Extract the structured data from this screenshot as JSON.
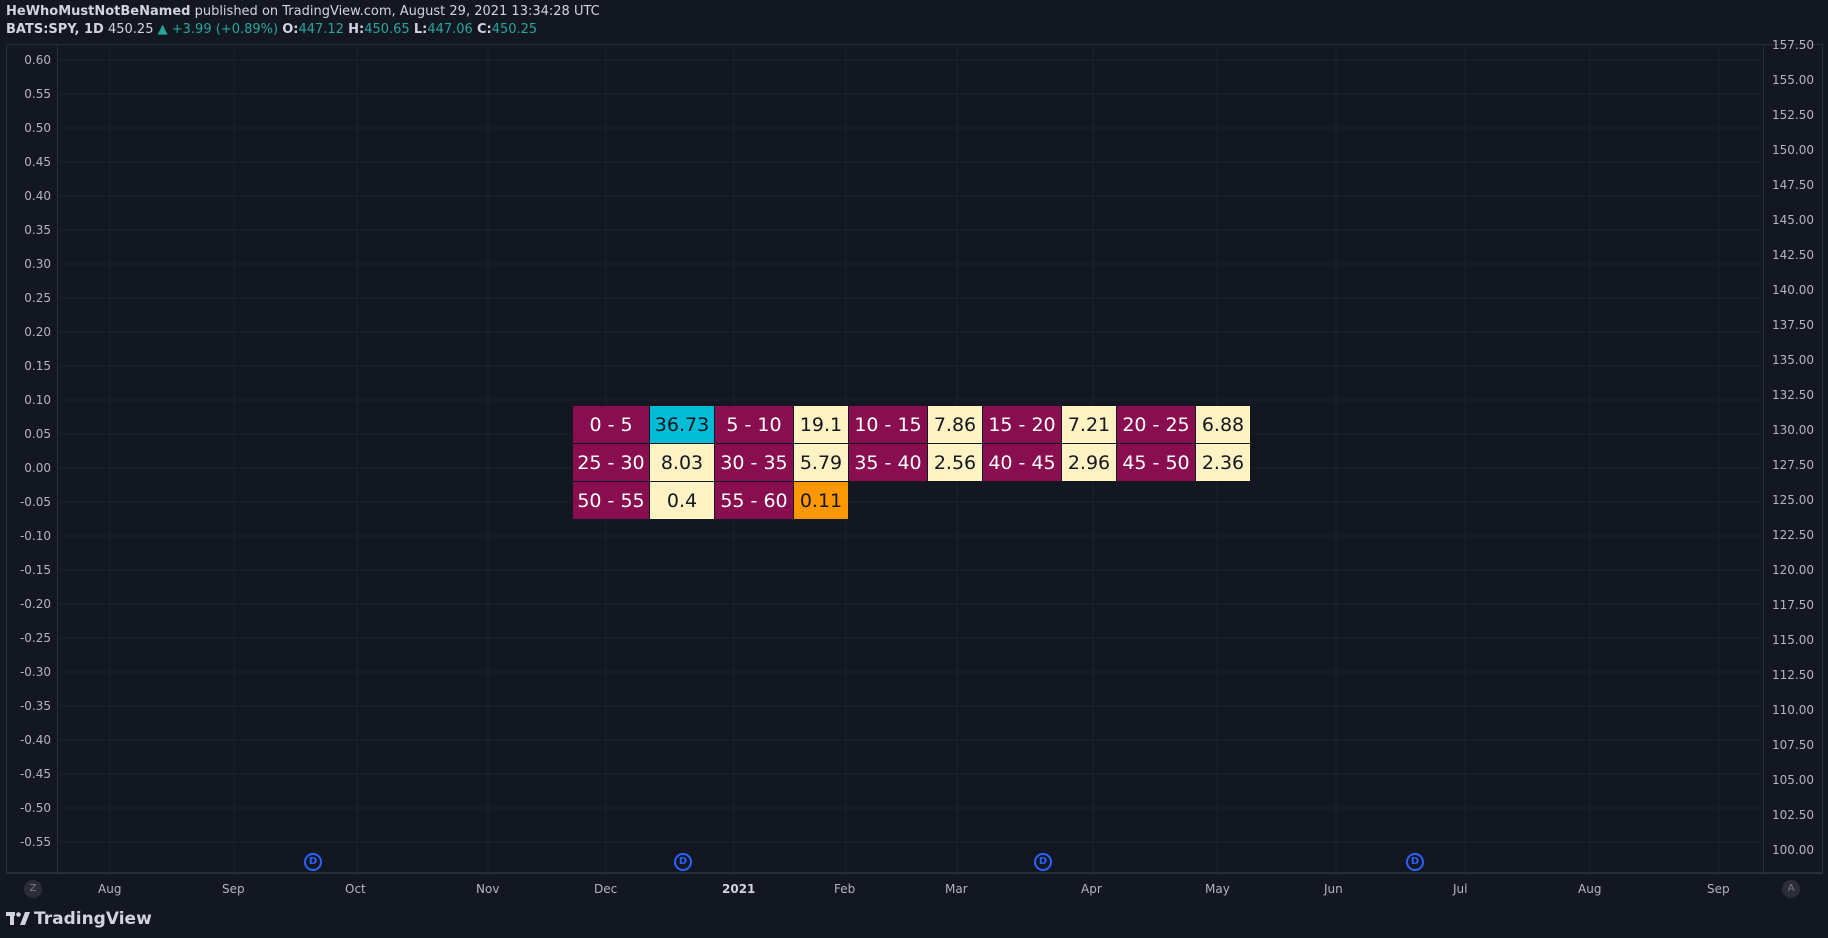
{
  "header": {
    "author": "HeWhoMustNotBeNamed",
    "published": "published on TradingView.com, August 29, 2021 13:34:28 UTC",
    "symbol": "BATS:SPY, 1D",
    "price": "450.25",
    "change": "▲ +3.99 (+0.89%)",
    "open_label": "O:",
    "open": "447.12",
    "high_label": "H:",
    "high": "450.65",
    "low_label": "L:",
    "low": "447.06",
    "close_label": "C:",
    "close": "450.25"
  },
  "left_axis": [
    "0.60",
    "0.55",
    "0.50",
    "0.45",
    "0.40",
    "0.35",
    "0.30",
    "0.25",
    "0.20",
    "0.15",
    "0.10",
    "0.05",
    "0.00",
    "-0.05",
    "-0.10",
    "-0.15",
    "-0.20",
    "-0.25",
    "-0.30",
    "-0.35",
    "-0.40",
    "-0.45",
    "-0.50",
    "-0.55"
  ],
  "right_axis": [
    "157.50",
    "155.00",
    "152.50",
    "150.00",
    "147.50",
    "145.00",
    "142.50",
    "140.00",
    "137.50",
    "135.00",
    "132.50",
    "130.00",
    "127.50",
    "125.00",
    "122.50",
    "120.00",
    "117.50",
    "115.00",
    "112.50",
    "110.00",
    "107.50",
    "105.00",
    "102.50",
    "100.00"
  ],
  "x_axis": [
    "Aug",
    "Sep",
    "Oct",
    "Nov",
    "Dec",
    "2021",
    "Feb",
    "Mar",
    "Apr",
    "May",
    "Jun",
    "Jul",
    "Aug",
    "Sep"
  ],
  "axis_buttons": {
    "left": "Z",
    "right": "A"
  },
  "dividend_marker": "D",
  "table": {
    "rows": [
      [
        {
          "range": "0 - 5",
          "value": "36.73"
        },
        {
          "range": "5 - 10",
          "value": "19.1"
        },
        {
          "range": "10 - 15",
          "value": "7.86"
        },
        {
          "range": "15 - 20",
          "value": "7.21"
        },
        {
          "range": "20 - 25",
          "value": "6.88"
        }
      ],
      [
        {
          "range": "25 - 30",
          "value": "8.03"
        },
        {
          "range": "30 - 35",
          "value": "5.79"
        },
        {
          "range": "35 - 40",
          "value": "2.56"
        },
        {
          "range": "40 - 45",
          "value": "2.96"
        },
        {
          "range": "45 - 50",
          "value": "2.36"
        }
      ],
      [
        {
          "range": "50 - 55",
          "value": "0.4"
        },
        {
          "range": "55 - 60",
          "value": "0.11"
        }
      ]
    ]
  },
  "colors": {
    "background": "#131722",
    "range_cell": "#880e4f",
    "value_cell": "#fff3c4",
    "highest": "#00bcd4",
    "lowest": "#ff9800",
    "up": "#26a69a",
    "dividend": "#2962ff"
  },
  "footer": {
    "brand": "TradingView"
  }
}
